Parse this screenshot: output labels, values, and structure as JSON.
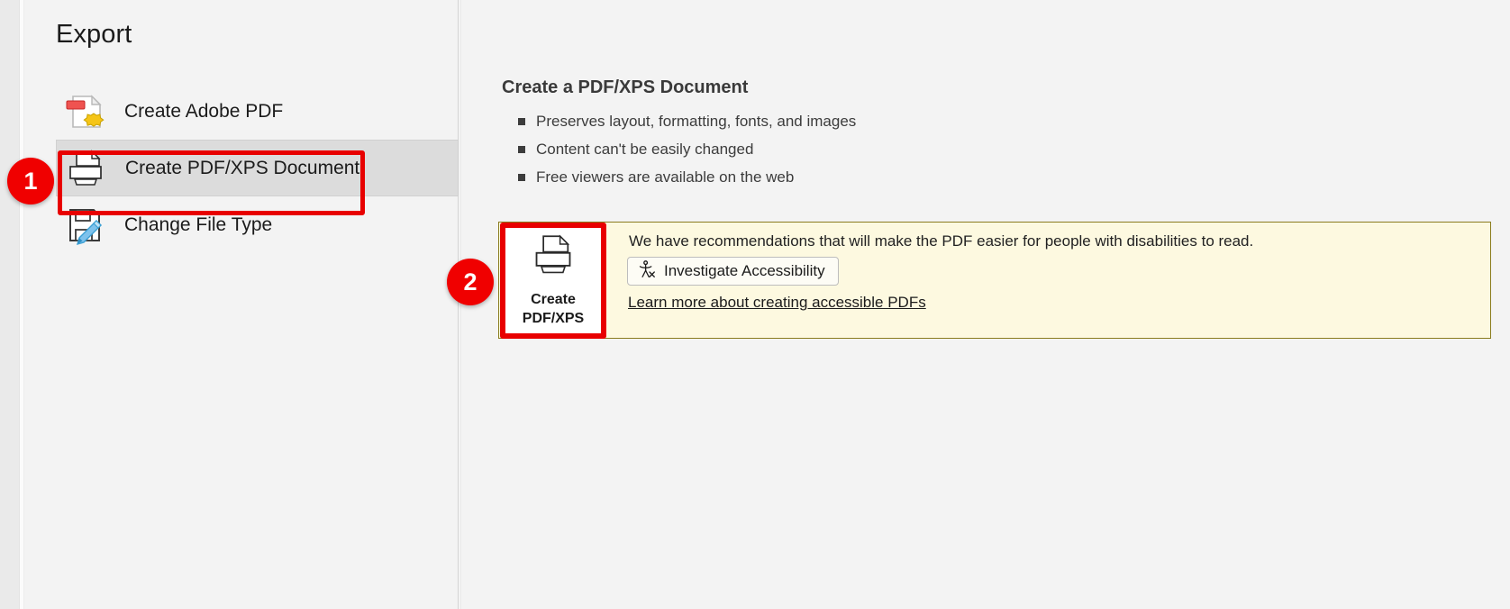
{
  "page_title": "Export",
  "sidebar": {
    "items": [
      {
        "label": "Create Adobe PDF",
        "icon": "adobe-pdf-icon",
        "selected": false
      },
      {
        "label": "Create PDF/XPS Document",
        "icon": "pdf-xps-document-icon",
        "selected": true
      },
      {
        "label": "Change File Type",
        "icon": "change-file-type-icon",
        "selected": false
      }
    ]
  },
  "detail": {
    "heading": "Create a PDF/XPS Document",
    "bullets": [
      "Preserves layout, formatting, fonts, and images",
      "Content can't be easily changed",
      "Free viewers are available on the web"
    ]
  },
  "accessibility_banner": {
    "message": "We have recommendations that will make the PDF easier for people with disabilities to read.",
    "investigate_button": "Investigate Accessibility",
    "investigate_icon": "accessibility-person-icon",
    "link": "Learn more about creating accessible PDFs",
    "background_color": "#fdf9e0",
    "border_color": "#8a7c1e"
  },
  "create_button": {
    "line1": "Create",
    "line2": "PDF/XPS",
    "icon": "pdf-xps-printer-icon"
  },
  "annotations": {
    "badges": [
      {
        "number": "1"
      },
      {
        "number": "2"
      }
    ],
    "highlight_color": "#e80000",
    "badge_color": "#f00000"
  }
}
